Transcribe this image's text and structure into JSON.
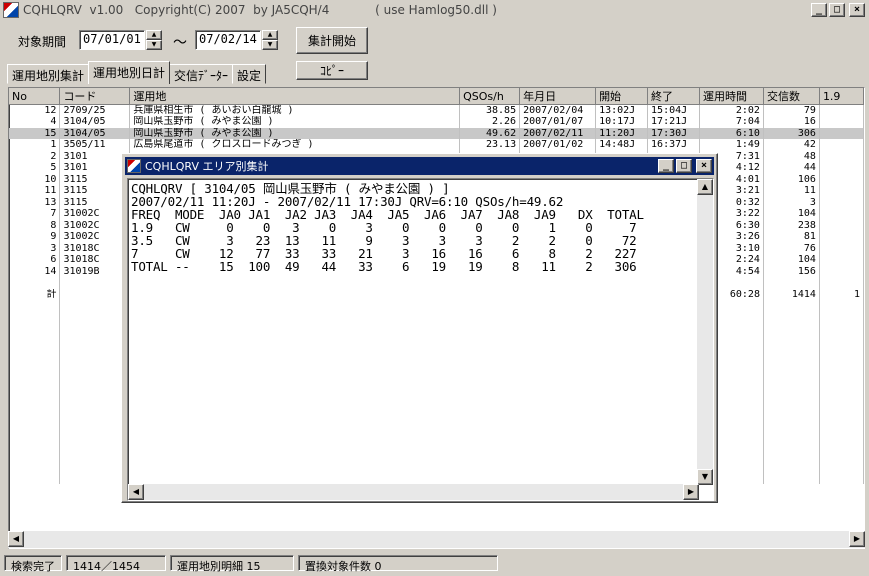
{
  "window": {
    "title": "CQHLQRV  v1.00   Copyright(C) 2007  by JA5CQH/4            ( use Hamlog50.dll )"
  },
  "toolbar": {
    "period_label": "対象期間",
    "date_from": "07/01/01",
    "tilde": "～",
    "date_to": "07/02/14",
    "run_button": "集計開始",
    "copy_button": "ｺﾋﾟｰ"
  },
  "tabs": [
    {
      "label": "運用地別集計",
      "active": false
    },
    {
      "label": "運用地別日計",
      "active": true
    },
    {
      "label": "交信ﾃﾞｰﾀｰ",
      "active": false
    },
    {
      "label": "設定",
      "active": false
    }
  ],
  "table": {
    "columns": [
      "No",
      "コード",
      "運用地",
      "QSOs/h",
      "年月日",
      "開始",
      "終了",
      "運用時間",
      "交信数",
      "1.9"
    ],
    "rows": [
      {
        "no": "12",
        "code": "2709/25",
        "place": "兵庫県相生市 ( あいおい白龍城 )",
        "qsoh": "38.85",
        "date": "2007/02/04",
        "start": "13:02J",
        "end": "15:04J",
        "time": "2:02",
        "count": "79",
        "b19": ""
      },
      {
        "no": "4",
        "code": "3104/05",
        "place": "岡山県玉野市 ( みやま公園 )",
        "qsoh": "2.26",
        "date": "2007/01/07",
        "start": "10:17J",
        "end": "17:21J",
        "time": "7:04",
        "count": "16",
        "b19": ""
      },
      {
        "no": "15",
        "code": "3104/05",
        "place": "岡山県玉野市 ( みやま公園 )",
        "qsoh": "49.62",
        "date": "2007/02/11",
        "start": "11:20J",
        "end": "17:30J",
        "time": "6:10",
        "count": "306",
        "b19": "",
        "selected": true
      },
      {
        "no": "1",
        "code": "3505/11",
        "place": "広島県尾道市 ( クロスロードみつぎ )",
        "qsoh": "23.13",
        "date": "2007/01/02",
        "start": "14:48J",
        "end": "16:37J",
        "time": "1:49",
        "count": "42",
        "b19": ""
      },
      {
        "no": "2",
        "code": "3101",
        "place": "",
        "qsoh": "",
        "date": "",
        "start": "",
        "end": "",
        "time": "7:31",
        "count": "48",
        "b19": ""
      },
      {
        "no": "5",
        "code": "3101",
        "place": "",
        "qsoh": "",
        "date": "",
        "start": "",
        "end": "",
        "time": "4:12",
        "count": "44",
        "b19": ""
      },
      {
        "no": "10",
        "code": "3115",
        "place": "",
        "qsoh": "",
        "date": "",
        "start": "",
        "end": "",
        "time": "4:01",
        "count": "106",
        "b19": ""
      },
      {
        "no": "11",
        "code": "3115",
        "place": "",
        "qsoh": "",
        "date": "",
        "start": "",
        "end": "",
        "time": "3:21",
        "count": "11",
        "b19": ""
      },
      {
        "no": "13",
        "code": "3115",
        "place": "",
        "qsoh": "",
        "date": "",
        "start": "",
        "end": "",
        "time": "0:32",
        "count": "3",
        "b19": ""
      },
      {
        "no": "7",
        "code": "31002C",
        "place": "",
        "qsoh": "",
        "date": "",
        "start": "",
        "end": "",
        "time": "3:22",
        "count": "104",
        "b19": ""
      },
      {
        "no": "8",
        "code": "31002C",
        "place": "",
        "qsoh": "",
        "date": "",
        "start": "",
        "end": "",
        "time": "6:30",
        "count": "238",
        "b19": ""
      },
      {
        "no": "9",
        "code": "31002C",
        "place": "",
        "qsoh": "",
        "date": "",
        "start": "",
        "end": "",
        "time": "3:26",
        "count": "81",
        "b19": ""
      },
      {
        "no": "3",
        "code": "31018C",
        "place": "",
        "qsoh": "",
        "date": "",
        "start": "",
        "end": "",
        "time": "3:10",
        "count": "76",
        "b19": ""
      },
      {
        "no": "6",
        "code": "31018C",
        "place": "",
        "qsoh": "",
        "date": "",
        "start": "",
        "end": "",
        "time": "2:24",
        "count": "104",
        "b19": ""
      },
      {
        "no": "14",
        "code": "31019B",
        "place": "",
        "qsoh": "",
        "date": "",
        "start": "",
        "end": "",
        "time": "4:54",
        "count": "156",
        "b19": ""
      }
    ],
    "total": {
      "label": "計",
      "time": "60:28",
      "count": "1414",
      "b19": "1"
    }
  },
  "popup": {
    "title": "CQHLQRV  エリア別集計",
    "lines": [
      "CQHLQRV [ 3104/05 岡山県玉野市 ( みやま公園 ) ]",
      "2007/02/11 11:20J - 2007/02/11 17:30J QRV=6:10 QSOs/h=49.62",
      "FREQ  MODE  JA0 JA1  JA2 JA3  JA4  JA5  JA6  JA7  JA8  JA9   DX  TOTAL",
      "1.9   CW     0    0   3    0    3    0    0    0    0    1    0     7",
      "3.5   CW     3   23  13   11    9    3    3    3    2    2    0    72",
      "7     CW    12   77  33   33   21    3   16   16    6    8    2   227",
      "TOTAL --    15  100  49   44   33    6   19   19    8   11    2   306"
    ]
  },
  "status": {
    "state": "検索完了",
    "progress": "1414／1454",
    "detail": "運用地別明細 15",
    "replace": "置換対象件数 0"
  }
}
